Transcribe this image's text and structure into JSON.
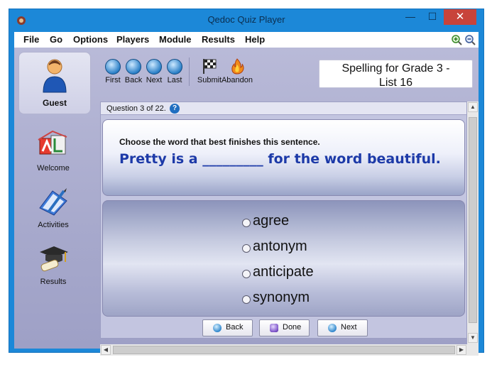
{
  "window": {
    "title": "Qedoc Quiz Player"
  },
  "menu": {
    "items": [
      "File",
      "Go",
      "Options",
      "Players",
      "Module",
      "Results",
      "Help"
    ]
  },
  "sidebar": {
    "user": "Guest",
    "items": [
      {
        "label": "Welcome",
        "icon": "alphabet-blocks-icon"
      },
      {
        "label": "Activities",
        "icon": "book-pencil-icon"
      },
      {
        "label": "Results",
        "icon": "graduation-cap-icon"
      }
    ]
  },
  "toolbar": {
    "first": "First",
    "back": "Back",
    "next": "Next",
    "last": "Last",
    "submit": "Submit",
    "abandon": "Abandon"
  },
  "module": {
    "title_line1": "Spelling for Grade 3 -",
    "title_line2": "List 16"
  },
  "question": {
    "counter": "Question 3 of 22.",
    "instruction": "Choose the word that best finishes this sentence.",
    "text": "Pretty is a _________ for the word beautiful.",
    "answers": [
      "agree",
      "antonym",
      "anticipate",
      "synonym"
    ]
  },
  "nav": {
    "back": "Back",
    "done": "Done",
    "next": "Next"
  },
  "colors": {
    "accent": "#1c88d8",
    "question_text": "#1d3aa8",
    "close": "#c8433a"
  }
}
